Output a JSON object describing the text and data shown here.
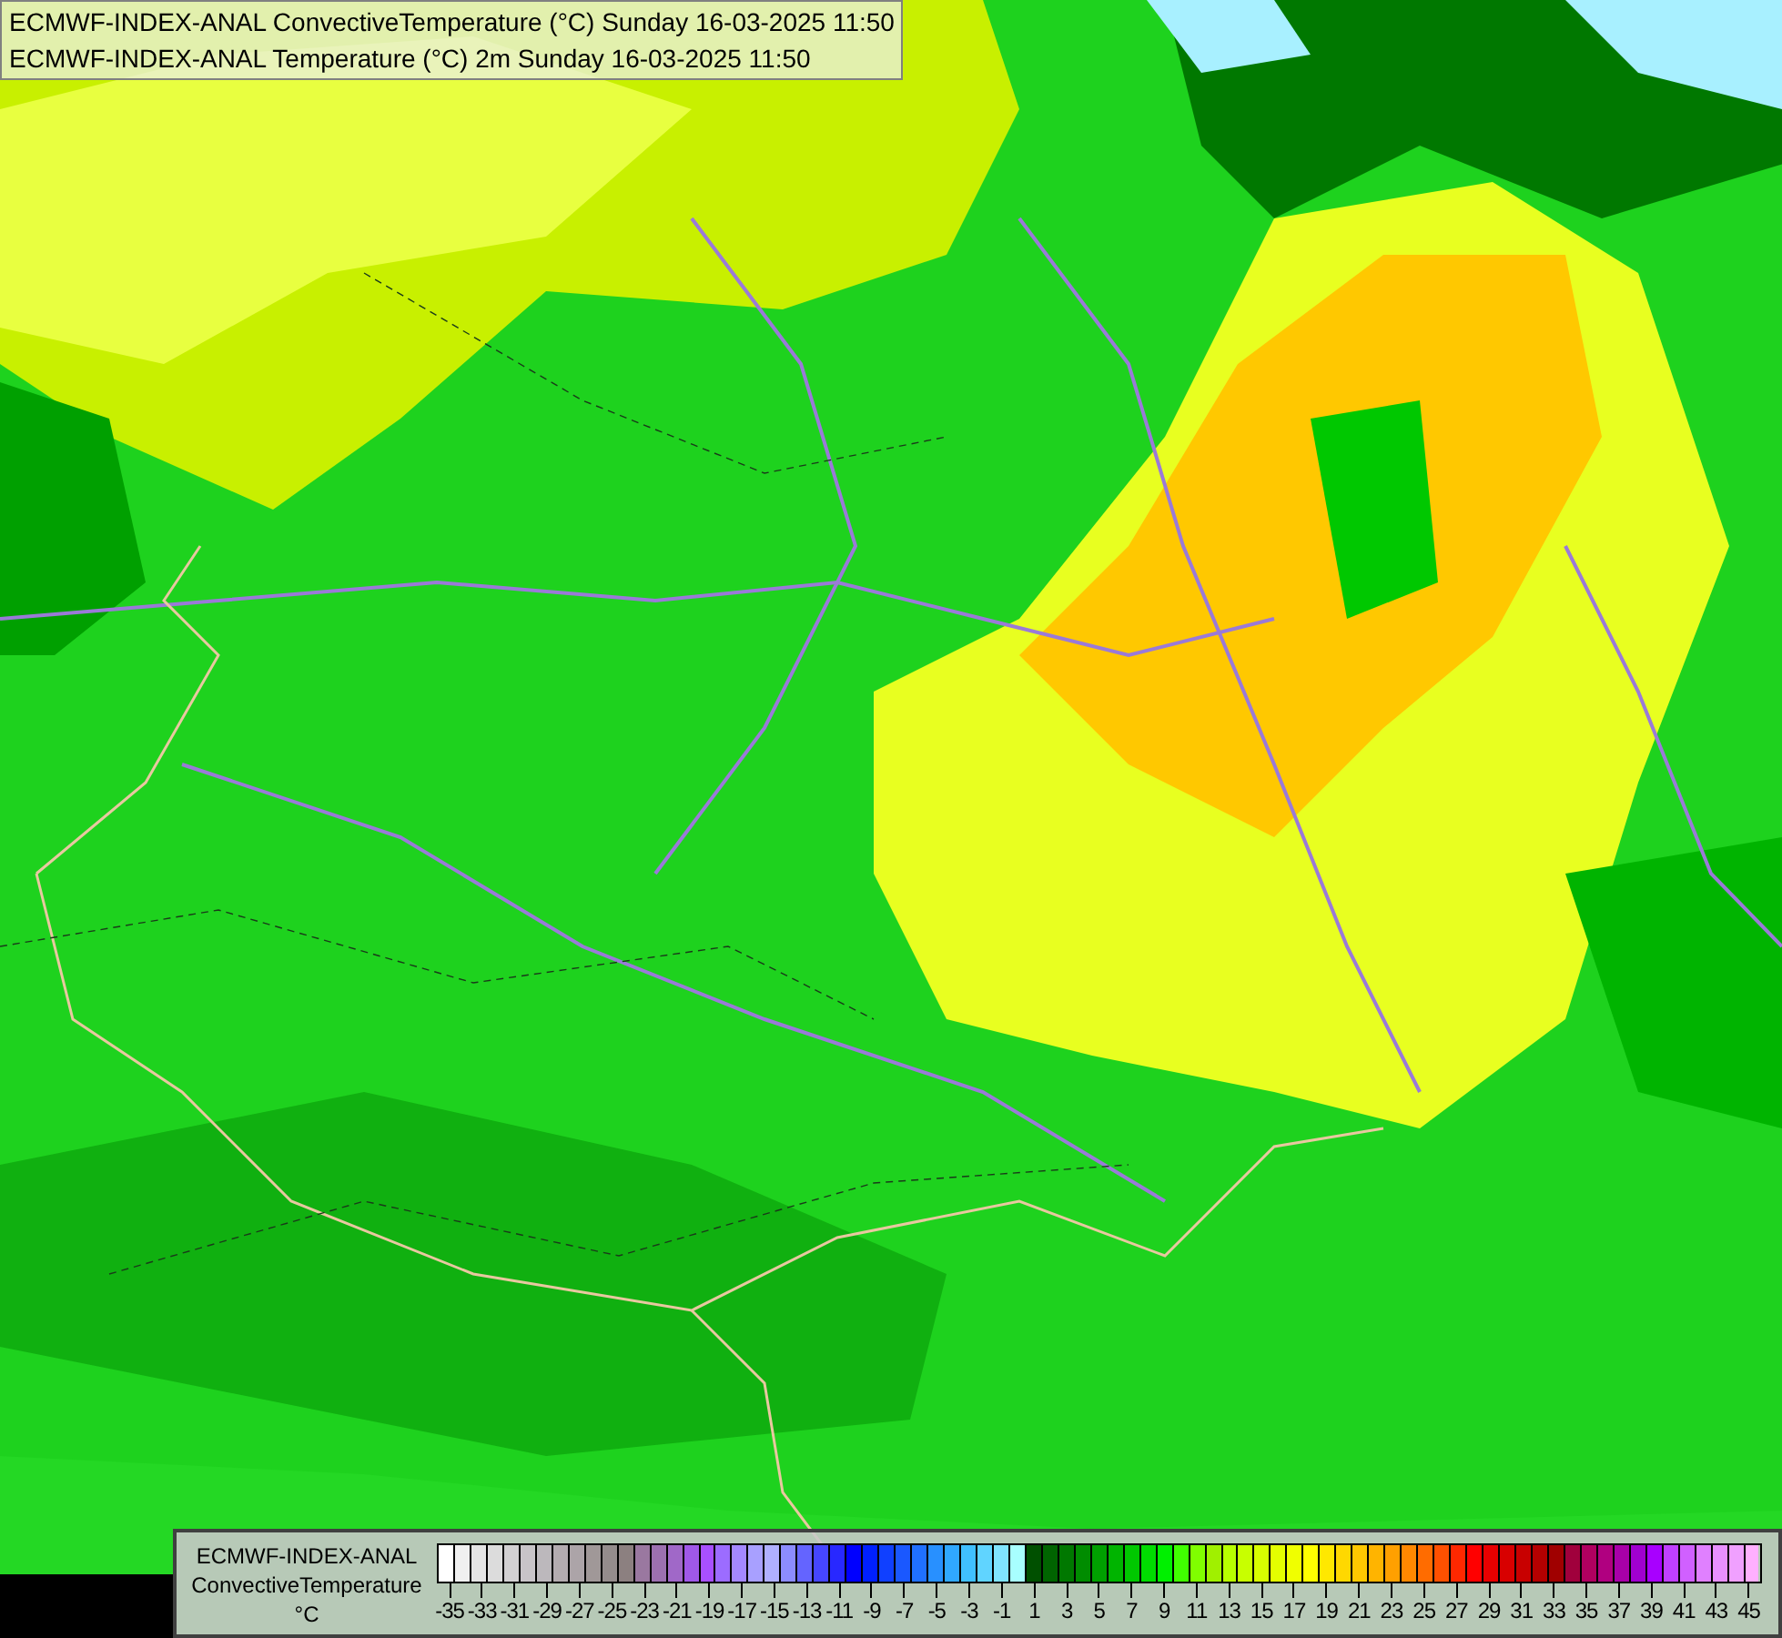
{
  "header": {
    "lines": [
      "ECMWF-INDEX-ANAL ConvectiveTemperature (°C) Sunday 16-03-2025 11:50",
      "ECMWF-INDEX-ANAL Temperature (°C) 2m Sunday 16-03-2025 11:50"
    ]
  },
  "legend": {
    "title_lines": [
      "ECMWF-INDEX-ANAL",
      "ConvectiveTemperature",
      "°C"
    ],
    "swatches": [
      {
        "color": "#ffffff"
      },
      {
        "color": "#f0f0f0"
      },
      {
        "color": "#e4e4e4"
      },
      {
        "color": "#dcdcdc"
      },
      {
        "color": "#d2d0d2"
      },
      {
        "color": "#c8c4c8"
      },
      {
        "color": "#bcb8bc"
      },
      {
        "color": "#b4acb0"
      },
      {
        "color": "#aca4a8"
      },
      {
        "color": "#a09898"
      },
      {
        "color": "#948c8c"
      },
      {
        "color": "#8c8080"
      },
      {
        "color": "#9a78a0"
      },
      {
        "color": "#9c70b0"
      },
      {
        "color": "#a068c8"
      },
      {
        "color": "#a058e8"
      },
      {
        "color": "#a850ff"
      },
      {
        "color": "#9c6cff"
      },
      {
        "color": "#a488ff"
      },
      {
        "color": "#a8a0ff"
      },
      {
        "color": "#b0b0ff"
      },
      {
        "color": "#8c8cff"
      },
      {
        "color": "#6464ff"
      },
      {
        "color": "#4646ff"
      },
      {
        "color": "#2828ff"
      },
      {
        "color": "#0000ff"
      },
      {
        "color": "#0020ff"
      },
      {
        "color": "#1040ff"
      },
      {
        "color": "#1a58ff"
      },
      {
        "color": "#2070ff"
      },
      {
        "color": "#2890ff"
      },
      {
        "color": "#30a8ff"
      },
      {
        "color": "#40c0ff"
      },
      {
        "color": "#60d4ff"
      },
      {
        "color": "#80e4ff"
      },
      {
        "color": "#a8ffff"
      },
      {
        "color": "#005000"
      },
      {
        "color": "#006400"
      },
      {
        "color": "#007800"
      },
      {
        "color": "#008c00"
      },
      {
        "color": "#00a000"
      },
      {
        "color": "#00b400"
      },
      {
        "color": "#00c800"
      },
      {
        "color": "#00dc00"
      },
      {
        "color": "#00f000"
      },
      {
        "color": "#40ff00"
      },
      {
        "color": "#80ff00"
      },
      {
        "color": "#a0f000"
      },
      {
        "color": "#b8ff00"
      },
      {
        "color": "#c8ff00"
      },
      {
        "color": "#d8ff00"
      },
      {
        "color": "#e4ff00"
      },
      {
        "color": "#f0ff00"
      },
      {
        "color": "#ffff00"
      },
      {
        "color": "#ffe800"
      },
      {
        "color": "#ffd800"
      },
      {
        "color": "#ffc800"
      },
      {
        "color": "#ffb400"
      },
      {
        "color": "#ffa000"
      },
      {
        "color": "#ff8800"
      },
      {
        "color": "#ff6c00"
      },
      {
        "color": "#ff5000"
      },
      {
        "color": "#ff2800"
      },
      {
        "color": "#ff0000"
      },
      {
        "color": "#e80000"
      },
      {
        "color": "#d80000"
      },
      {
        "color": "#c80000"
      },
      {
        "color": "#b40000"
      },
      {
        "color": "#a00000"
      },
      {
        "color": "#a0003c"
      },
      {
        "color": "#b00060"
      },
      {
        "color": "#b00080"
      },
      {
        "color": "#a800a8"
      },
      {
        "color": "#a000d0"
      },
      {
        "color": "#a800ff"
      },
      {
        "color": "#c040ff"
      },
      {
        "color": "#d060ff"
      },
      {
        "color": "#e080ff"
      },
      {
        "color": "#e890ff"
      },
      {
        "color": "#f0a0ff"
      },
      {
        "color": "#ffb0ff"
      }
    ],
    "ticks": [
      "-35",
      "-33",
      "-31",
      "-29",
      "-27",
      "-25",
      "-23",
      "-21",
      "-19",
      "-17",
      "-15",
      "-13",
      "-11",
      "-9",
      "-7",
      "-5",
      "-3",
      "-1",
      "1",
      "3",
      "5",
      "7",
      "9",
      "11",
      "13",
      "15",
      "17",
      "19",
      "21",
      "23",
      "25",
      "27",
      "29",
      "31",
      "33",
      "35",
      "37",
      "39",
      "41",
      "43",
      "45"
    ]
  }
}
